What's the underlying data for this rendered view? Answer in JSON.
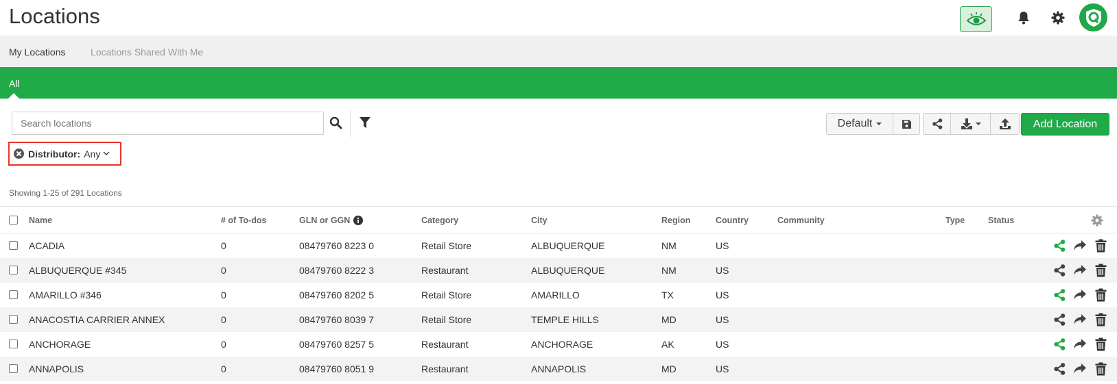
{
  "header": {
    "title": "Locations",
    "icons": [
      "eye-icon",
      "bell-icon",
      "gear-icon",
      "avatar-logo"
    ],
    "accent": "#20ab48"
  },
  "tabs": [
    {
      "label": "My Locations",
      "active": true
    },
    {
      "label": "Locations Shared With Me",
      "active": false
    }
  ],
  "subnav": {
    "label": "All"
  },
  "toolbar": {
    "search_placeholder": "Search locations",
    "view_label": "Default",
    "add_label": "Add Location",
    "icons": [
      "search-icon",
      "filter-icon",
      "save-icon",
      "share-icon",
      "download-icon",
      "upload-icon"
    ]
  },
  "filter_chip": {
    "label": "Distributor:",
    "value": "Any",
    "highlight": "#e8342b"
  },
  "summary": "Showing 1-25 of 291 Locations",
  "table": {
    "columns": [
      "Name",
      "# of To-dos",
      "GLN or GGN",
      "Category",
      "City",
      "Region",
      "Country",
      "Community",
      "Type",
      "Status"
    ],
    "rows": [
      {
        "name": "ACADIA",
        "todos": "0",
        "gln": "08479760 8223 0",
        "category": "Retail Store",
        "city": "ALBUQUERQUE",
        "region": "NM",
        "country": "US",
        "shared": true
      },
      {
        "name": "ALBUQUERQUE #345",
        "todos": "0",
        "gln": "08479760 8222 3",
        "category": "Restaurant",
        "city": "ALBUQUERQUE",
        "region": "NM",
        "country": "US",
        "shared": false
      },
      {
        "name": "AMARILLO #346",
        "todos": "0",
        "gln": "08479760 8202 5",
        "category": "Retail Store",
        "city": "AMARILLO",
        "region": "TX",
        "country": "US",
        "shared": true
      },
      {
        "name": "ANACOSTIA CARRIER ANNEX",
        "todos": "0",
        "gln": "08479760 8039 7",
        "category": "Retail Store",
        "city": "TEMPLE HILLS",
        "region": "MD",
        "country": "US",
        "shared": false
      },
      {
        "name": "ANCHORAGE",
        "todos": "0",
        "gln": "08479760 8257 5",
        "category": "Restaurant",
        "city": "ANCHORAGE",
        "region": "AK",
        "country": "US",
        "shared": true
      },
      {
        "name": "ANNAPOLIS",
        "todos": "0",
        "gln": "08479760 8051 9",
        "category": "Restaurant",
        "city": "ANNAPOLIS",
        "region": "MD",
        "country": "US",
        "shared": false
      }
    ]
  }
}
